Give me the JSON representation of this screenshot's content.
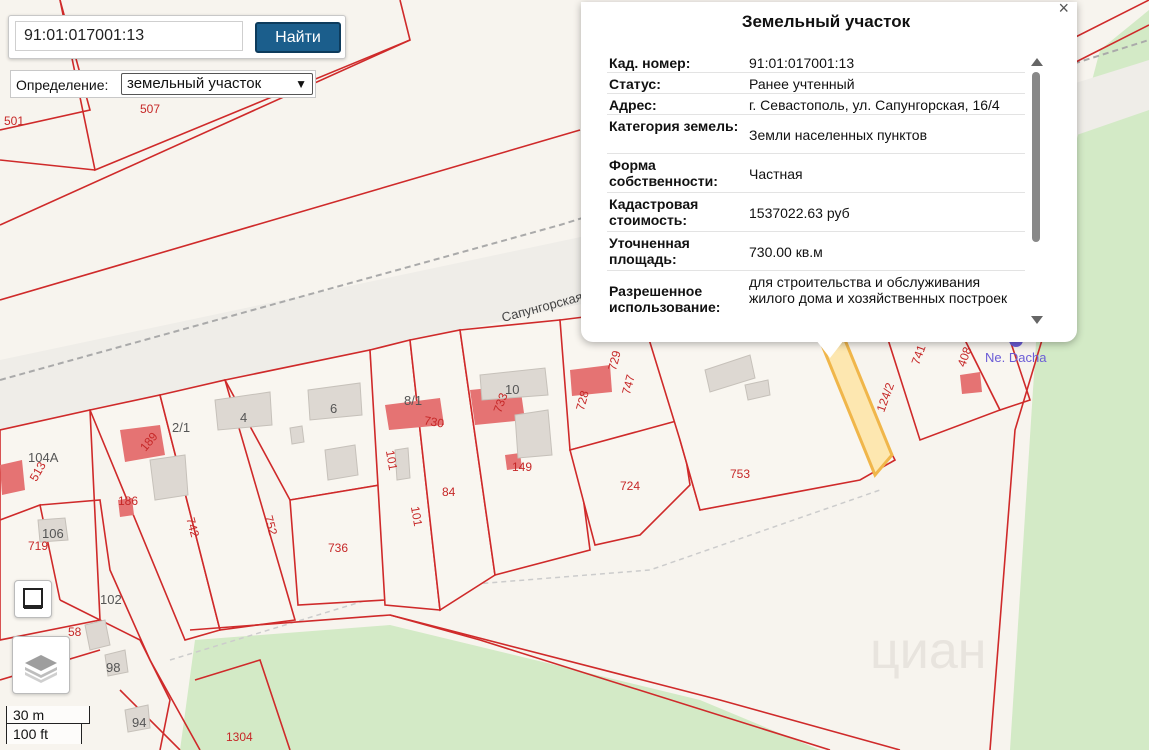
{
  "search": {
    "value": "91:01:017001:13",
    "button_label": "Найти"
  },
  "definition": {
    "label": "Определение:",
    "selected": "земельный участок"
  },
  "popup": {
    "title": "Земельный участок",
    "close_symbol": "×",
    "rows": [
      {
        "label": "Кад. номер",
        "value": "91:01:017001:13"
      },
      {
        "label": "Статус",
        "value": "Ранее учтенный"
      },
      {
        "label": "Адрес",
        "value": "г. Севастополь, ул. Сапунгорская, 16/4"
      },
      {
        "label": "Категория земель",
        "value": "Земли населенных пунктов"
      },
      {
        "label": "Форма собственности",
        "value": "Частная"
      },
      {
        "label": "Кадастровая стоимость",
        "value": "1537022.63 руб"
      },
      {
        "label": "Уточненная площадь",
        "value": "730.00 кв.м"
      },
      {
        "label": "Разрешенное использование",
        "value": "для строительства и обслуживания жилого дома и хозяйственных построек"
      }
    ]
  },
  "map": {
    "street_name": "Сапунгорская",
    "poi_name": "Ne. Dacha",
    "watermark": "циан",
    "parcel_labels": {
      "p501": "501",
      "p507": "507",
      "p104a": "104А",
      "p513": "513",
      "p189": "189",
      "p2_1": "2/1",
      "p4": "4",
      "p6": "6",
      "p8_1": "8/1",
      "p730": "730",
      "p10": "10",
      "p733": "733",
      "p729": "729",
      "p747": "747",
      "p728": "728",
      "p124_2": "124/2",
      "p741": "741",
      "p408": "408",
      "p186": "186",
      "p106": "106",
      "p719": "719",
      "p742": "742",
      "p752": "752",
      "p101a": "101",
      "p149": "149",
      "p84": "84",
      "p724": "724",
      "p753": "753",
      "p736": "736",
      "p101b": "101",
      "p102": "102",
      "p58": "58",
      "p98": "98",
      "p94": "94",
      "p1304": "1304"
    }
  },
  "scale": {
    "metric": "30 m",
    "imperial": "100 ft"
  },
  "colors": {
    "parcel_line": "#cf2a2a",
    "building": "#e57373",
    "selected_fill": "#fde7b0",
    "selected_line": "#f0b64a",
    "green": "#cfe8c2",
    "button": "#1b5e8c"
  }
}
